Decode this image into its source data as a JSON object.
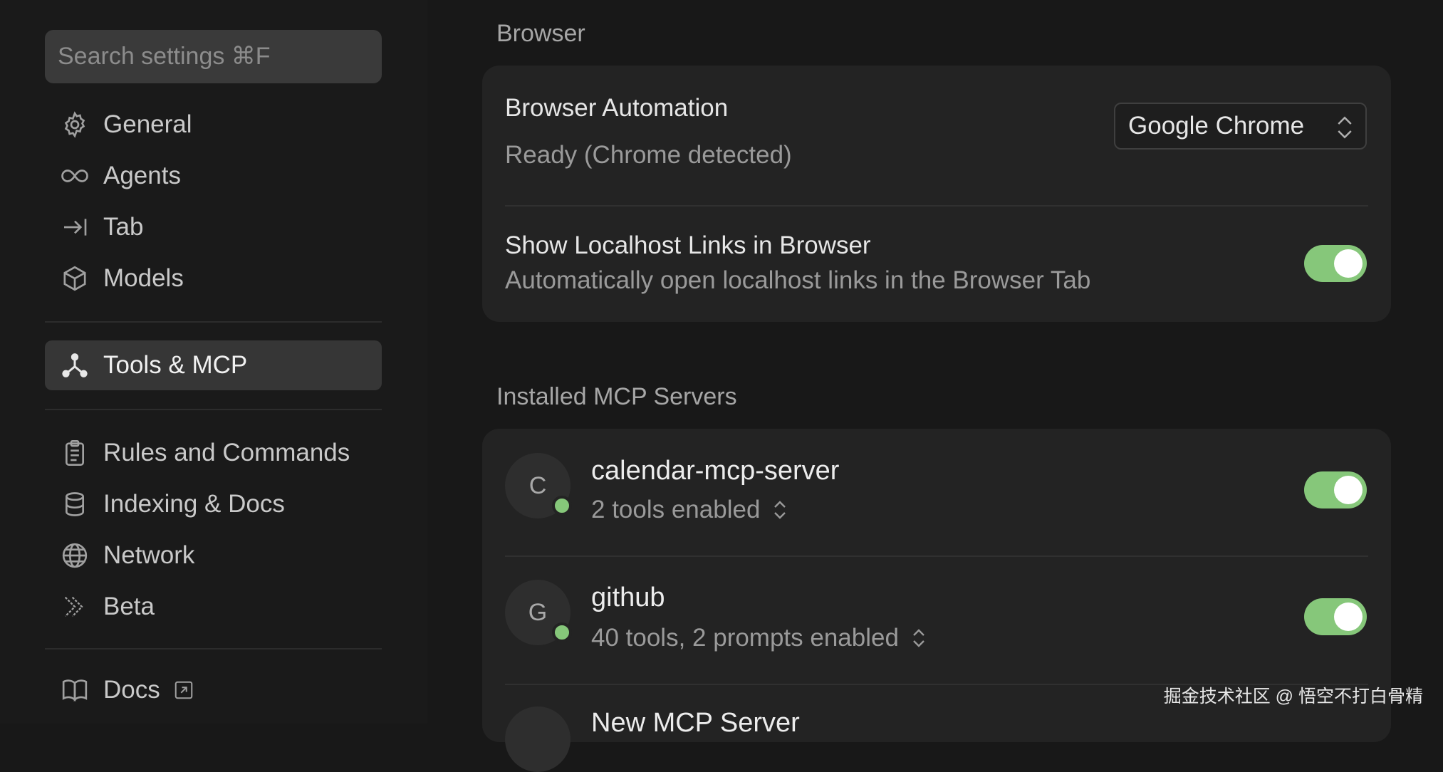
{
  "sidebar": {
    "search_placeholder": "Search settings ⌘F",
    "items": [
      {
        "label": "General",
        "icon": "gear-icon"
      },
      {
        "label": "Agents",
        "icon": "infinity-icon"
      },
      {
        "label": "Tab",
        "icon": "arrow-to-bar-icon"
      },
      {
        "label": "Models",
        "icon": "cube-icon"
      },
      {
        "label": "Tools & MCP",
        "icon": "network-nodes-icon",
        "active": true
      },
      {
        "label": "Rules and Commands",
        "icon": "clipboard-icon"
      },
      {
        "label": "Indexing & Docs",
        "icon": "database-icon"
      },
      {
        "label": "Network",
        "icon": "globe-icon"
      },
      {
        "label": "Beta",
        "icon": "double-chevron-icon"
      },
      {
        "label": "Docs",
        "icon": "book-icon",
        "external": true
      }
    ]
  },
  "browser": {
    "section_title": "Browser",
    "automation": {
      "title": "Browser Automation",
      "status": "Ready (Chrome detected)",
      "selected_browser": "Google Chrome"
    },
    "localhost": {
      "title": "Show Localhost Links in Browser",
      "description": "Automatically open localhost links in the Browser Tab",
      "enabled": true
    }
  },
  "mcp": {
    "section_title": "Installed MCP Servers",
    "servers": [
      {
        "initial": "C",
        "name": "calendar-mcp-server",
        "summary": "2 tools enabled",
        "enabled": true
      },
      {
        "initial": "G",
        "name": "github",
        "summary": "40 tools, 2 prompts enabled",
        "enabled": true
      },
      {
        "initial": "",
        "name": "New MCP Server",
        "summary": "",
        "enabled": false
      }
    ]
  },
  "colors": {
    "toggle_on": "#86c77a",
    "status_online": "#86c77a",
    "background": "#181818",
    "card": "#232323"
  },
  "watermark": "掘金技术社区 @ 悟空不打白骨精"
}
